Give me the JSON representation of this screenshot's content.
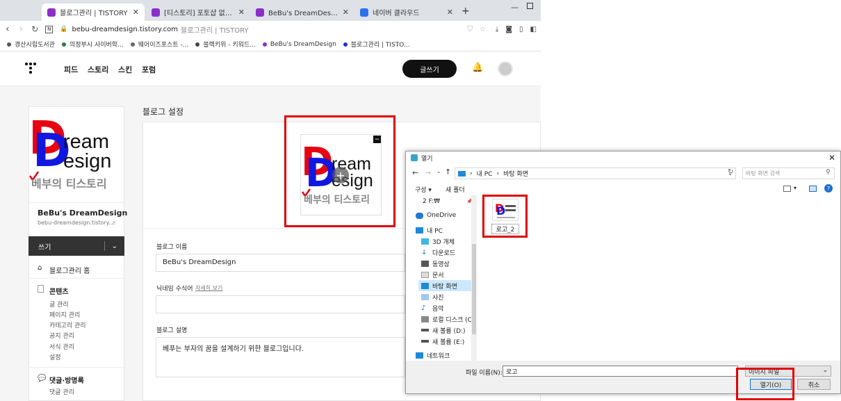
{
  "browser": {
    "tabs": [
      {
        "label": "블로그관리 | TISTORY",
        "active": true
      },
      {
        "label": "[티스토리] 포토샵 없이 아이콘",
        "active": false
      },
      {
        "label": "BeBu's DreamDesign :: 스킨편집",
        "active": false
      },
      {
        "label": "네이버 클라우드",
        "active": false
      }
    ],
    "new_tab": "+",
    "url_domain": "bebu-dreamdesign.tistory.com",
    "url_title": "블로그관리 | TISTORY",
    "bookmarks": [
      "경산시립도서관",
      "의정부시 사이버학...",
      "웨어이즈포스트 -...",
      "블랙키위 - 키워드...",
      "BeBu's DreamDesign",
      "블로그관리 | TISTO..."
    ]
  },
  "tistory": {
    "nav": [
      "피드",
      "스토리",
      "스킨",
      "포럼"
    ],
    "write_button": "글쓰기",
    "page_title": "블로그 설정",
    "blog_name": "BeBu's DreamDesign",
    "blog_url": "bebu-dreamdesign.tistory....",
    "write_label": "쓰기",
    "sidebar": {
      "home": "블로그관리 홈",
      "contents_title": "콘텐츠",
      "contents_items": [
        "글 관리",
        "페이지 관리",
        "카테고리 관리",
        "공지 관리",
        "서식 관리",
        "설정"
      ],
      "comments_title": "댓글·방명록",
      "comments_items": [
        "댓글 관리"
      ]
    },
    "logo": {
      "line1": "ream",
      "line2": "esign",
      "korean": "베부의 티스토리"
    },
    "form": {
      "name_label": "블로그 이름",
      "name_value": "BeBu's DreamDesign",
      "nickname_label": "닉네임 수식어",
      "nickname_link": "자세히 보기",
      "nickname_value": "",
      "desc_label": "블로그 설명",
      "desc_value": "베푸는 부자의 꿈을 설계하기 위한 블로그입니다."
    }
  },
  "dialog": {
    "title": "열기",
    "breadcrumb": [
      "내 PC",
      "바탕 화면"
    ],
    "search_placeholder": "바탕 화면 검색",
    "toolbar": {
      "organize": "구성 ▾",
      "new_folder": "새 폴더"
    },
    "tree": [
      "2 F:₩",
      "OneDrive",
      "내 PC",
      "3D 개체",
      "다운로드",
      "동영상",
      "문서",
      "바탕 화면",
      "사진",
      "음악",
      "로컬 디스크 (C:)",
      "새 볼륨 (D:)",
      "새 볼륨 (E:)",
      "네트워크"
    ],
    "selected_tree": "바탕 화면",
    "file": {
      "name": "로고_2"
    },
    "filename_label": "파일 이름(N):",
    "filename_value": "로고",
    "filetype": "이미지 파일",
    "open_button": "열기(O)",
    "cancel_button": "취소"
  },
  "colors": {
    "highlight_red": "#e00000",
    "logo_red": "#e60012",
    "logo_blue": "#1018e0"
  }
}
